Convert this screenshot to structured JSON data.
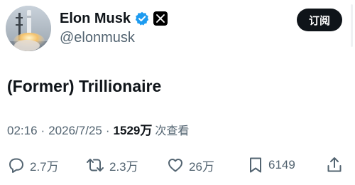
{
  "user": {
    "display_name": "Elon Musk",
    "handle": "@elonmusk",
    "verified": true,
    "verified_color": "#1d9bf0",
    "platform_icon": "x-logo-icon"
  },
  "header": {
    "subscribe_label": "订阅"
  },
  "tweet": {
    "text": "(Former) Trillionaire"
  },
  "meta": {
    "time": "02:16",
    "separator": "·",
    "date": "2026/7/25",
    "views": "1529万",
    "views_label": "次查看"
  },
  "actions": {
    "replies": "2.7万",
    "reposts": "2.3万",
    "likes": "26万",
    "bookmarks": "6149"
  },
  "colors": {
    "text": "#0f1419",
    "muted": "#536471",
    "button_bg": "#0f1419",
    "background": "#ffffff"
  }
}
